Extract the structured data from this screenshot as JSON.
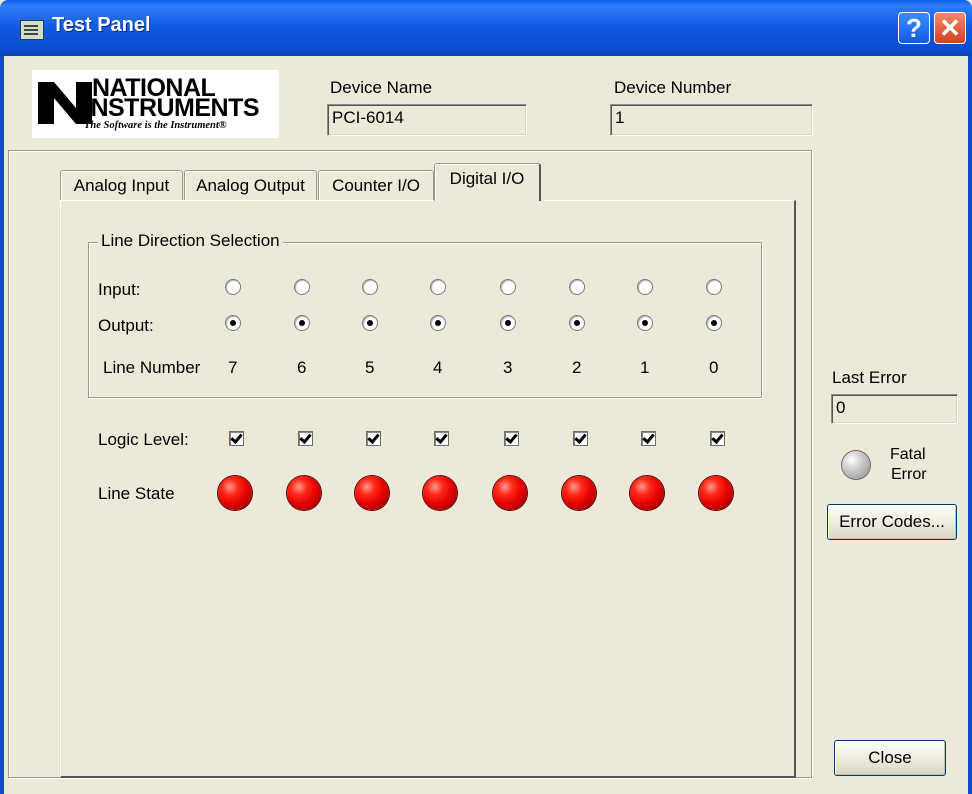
{
  "window": {
    "title": "Test Panel",
    "help_label": "?",
    "close_label": "✕"
  },
  "logo": {
    "line1": "NATIONAL",
    "line2": "INSTRUMENTS",
    "tagline": "The Software is the Instrument®"
  },
  "device": {
    "name_label": "Device Name",
    "name_value": "PCI-6014",
    "number_label": "Device Number",
    "number_value": "1"
  },
  "tabs": [
    {
      "label": "Analog Input",
      "active": false
    },
    {
      "label": "Analog Output",
      "active": false
    },
    {
      "label": "Counter I/O",
      "active": false
    },
    {
      "label": "Digital I/O",
      "active": true
    }
  ],
  "line_direction": {
    "legend": "Line Direction Selection",
    "input_label": "Input:",
    "output_label": "Output:",
    "line_number_label": "Line Number",
    "lines": [
      {
        "number": "7",
        "direction": "output"
      },
      {
        "number": "6",
        "direction": "output"
      },
      {
        "number": "5",
        "direction": "output"
      },
      {
        "number": "4",
        "direction": "output"
      },
      {
        "number": "3",
        "direction": "output"
      },
      {
        "number": "2",
        "direction": "output"
      },
      {
        "number": "1",
        "direction": "output"
      },
      {
        "number": "0",
        "direction": "output"
      }
    ]
  },
  "logic_level": {
    "label": "Logic Level:",
    "values": [
      true,
      true,
      true,
      true,
      true,
      true,
      true,
      true
    ]
  },
  "line_state": {
    "label": "Line State",
    "states": [
      "on",
      "on",
      "on",
      "on",
      "on",
      "on",
      "on",
      "on"
    ],
    "on_color": "#e00000"
  },
  "errors": {
    "last_error_label": "Last Error",
    "last_error_value": "0",
    "fatal_label_1": "Fatal",
    "fatal_label_2": "Error",
    "fatal_state": "off",
    "error_codes_button": "Error Codes..."
  },
  "close_button": "Close",
  "colors": {
    "titlebar": "#0a4ccc",
    "face": "#ece9d8",
    "led_on": "#e00000",
    "led_off": "#b0b0b0"
  }
}
